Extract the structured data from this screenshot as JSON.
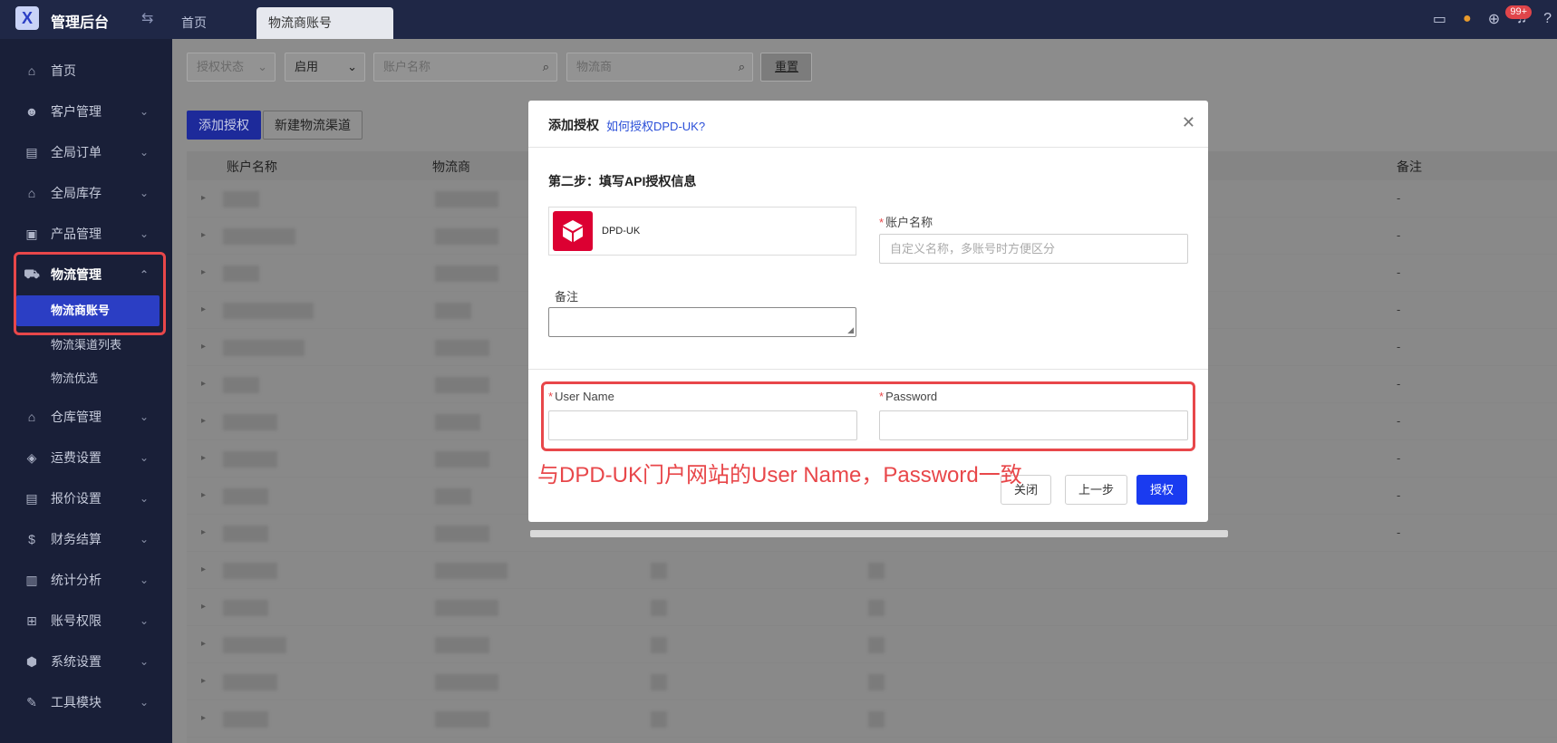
{
  "app": {
    "title": "管理后台",
    "logo_letter": "X"
  },
  "tabs": [
    {
      "label": "首页"
    },
    {
      "label": "物流商账号"
    }
  ],
  "header": {
    "badge": "99+"
  },
  "sidebar": {
    "items": [
      {
        "label": "首页",
        "icon": "home-icon"
      },
      {
        "label": "客户管理",
        "icon": "users-icon"
      },
      {
        "label": "全局订单",
        "icon": "orders-icon"
      },
      {
        "label": "全局库存",
        "icon": "warehouse-icon"
      },
      {
        "label": "产品管理",
        "icon": "bag-icon"
      },
      {
        "label": "物流管理",
        "icon": "truck-icon"
      },
      {
        "label": "仓库管理",
        "icon": "store-icon"
      },
      {
        "label": "运费设置",
        "icon": "freight-icon"
      },
      {
        "label": "报价设置",
        "icon": "quote-icon"
      },
      {
        "label": "财务结算",
        "icon": "finance-icon"
      },
      {
        "label": "统计分析",
        "icon": "chart-icon"
      },
      {
        "label": "账号权限",
        "icon": "org-icon"
      },
      {
        "label": "系统设置",
        "icon": "gear-icon"
      },
      {
        "label": "工具模块",
        "icon": "wrench-icon"
      }
    ],
    "sub_items": [
      {
        "label": "物流商账号"
      },
      {
        "label": "物流渠道列表"
      },
      {
        "label": "物流优选"
      }
    ]
  },
  "filters": {
    "auth_status": "授权状态",
    "enabled": "启用",
    "account_name_placeholder": "账户名称",
    "carrier_placeholder": "物流商",
    "reset": "重置"
  },
  "actions": {
    "add_auth": "添加授权",
    "new_channel": "新建物流渠道"
  },
  "table": {
    "columns": [
      "账户名称",
      "物流商",
      "备注"
    ],
    "rows": [
      {
        "remark": "-"
      },
      {
        "remark": "-"
      },
      {
        "remark": "-"
      },
      {
        "remark": "-"
      },
      {
        "remark": "-"
      },
      {
        "remark": "-"
      },
      {
        "remark": "-"
      },
      {
        "remark": "-"
      },
      {
        "remark": "-"
      },
      {
        "remark": "-"
      },
      {
        "remark": ""
      },
      {
        "remark": ""
      },
      {
        "remark": ""
      },
      {
        "remark": ""
      },
      {
        "remark": ""
      }
    ]
  },
  "modal": {
    "title": "添加授权",
    "help_link": "如何授权DPD-UK?",
    "step": "第二步：填写API授权信息",
    "carrier": {
      "name": "DPD-UK",
      "color": "#dc0032"
    },
    "account_label": "账户名称",
    "account_placeholder": "自定义名称，多账号时方便区分",
    "remark_label": "备注",
    "username_label": "User Name",
    "password_label": "Password",
    "buttons": {
      "close": "关闭",
      "prev": "上一步",
      "authorize": "授权"
    }
  },
  "annotation": "与DPD-UK门户网站的User Name，Password一致"
}
